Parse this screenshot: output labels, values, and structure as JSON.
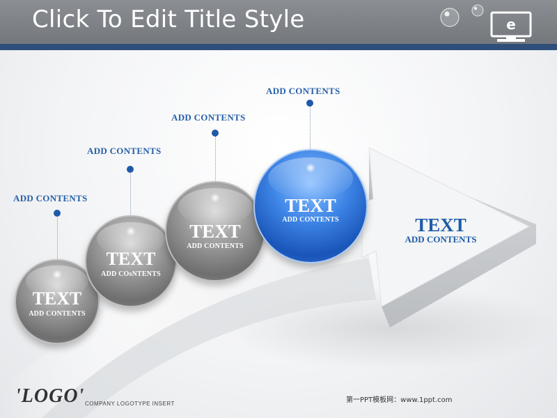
{
  "header": {
    "title": "Click To Edit Title Style",
    "icon_letter": "e"
  },
  "steps": [
    {
      "label": "ADD CONTENTS",
      "ball_title": "TEXT",
      "ball_sub": "ADD CONTENTS"
    },
    {
      "label": "ADD CONTENTS",
      "ball_title": "TEXT",
      "ball_sub": "ADD COsNTENTS"
    },
    {
      "label": "ADD CONTENTS",
      "ball_title": "TEXT",
      "ball_sub": "ADD CONTENTS"
    },
    {
      "label": "ADD CONTENTS",
      "ball_title": "TEXT",
      "ball_sub": "ADD CONTENTS"
    }
  ],
  "arrow": {
    "title": "TEXT",
    "sub": "ADD CONTENTS"
  },
  "footer": {
    "logo": "'LOGO'",
    "logo_tag": "COMPANY LOGOTYPE INSERT",
    "note": "第一PPT模板网：www.1ppt.com"
  },
  "colors": {
    "header_bg": "#7f8388",
    "header_stripe": "#2f4f7a",
    "accent_blue": "#1f5ca6",
    "ball_blue": "#3d85e6",
    "ball_gray": "#8a8a8a"
  }
}
